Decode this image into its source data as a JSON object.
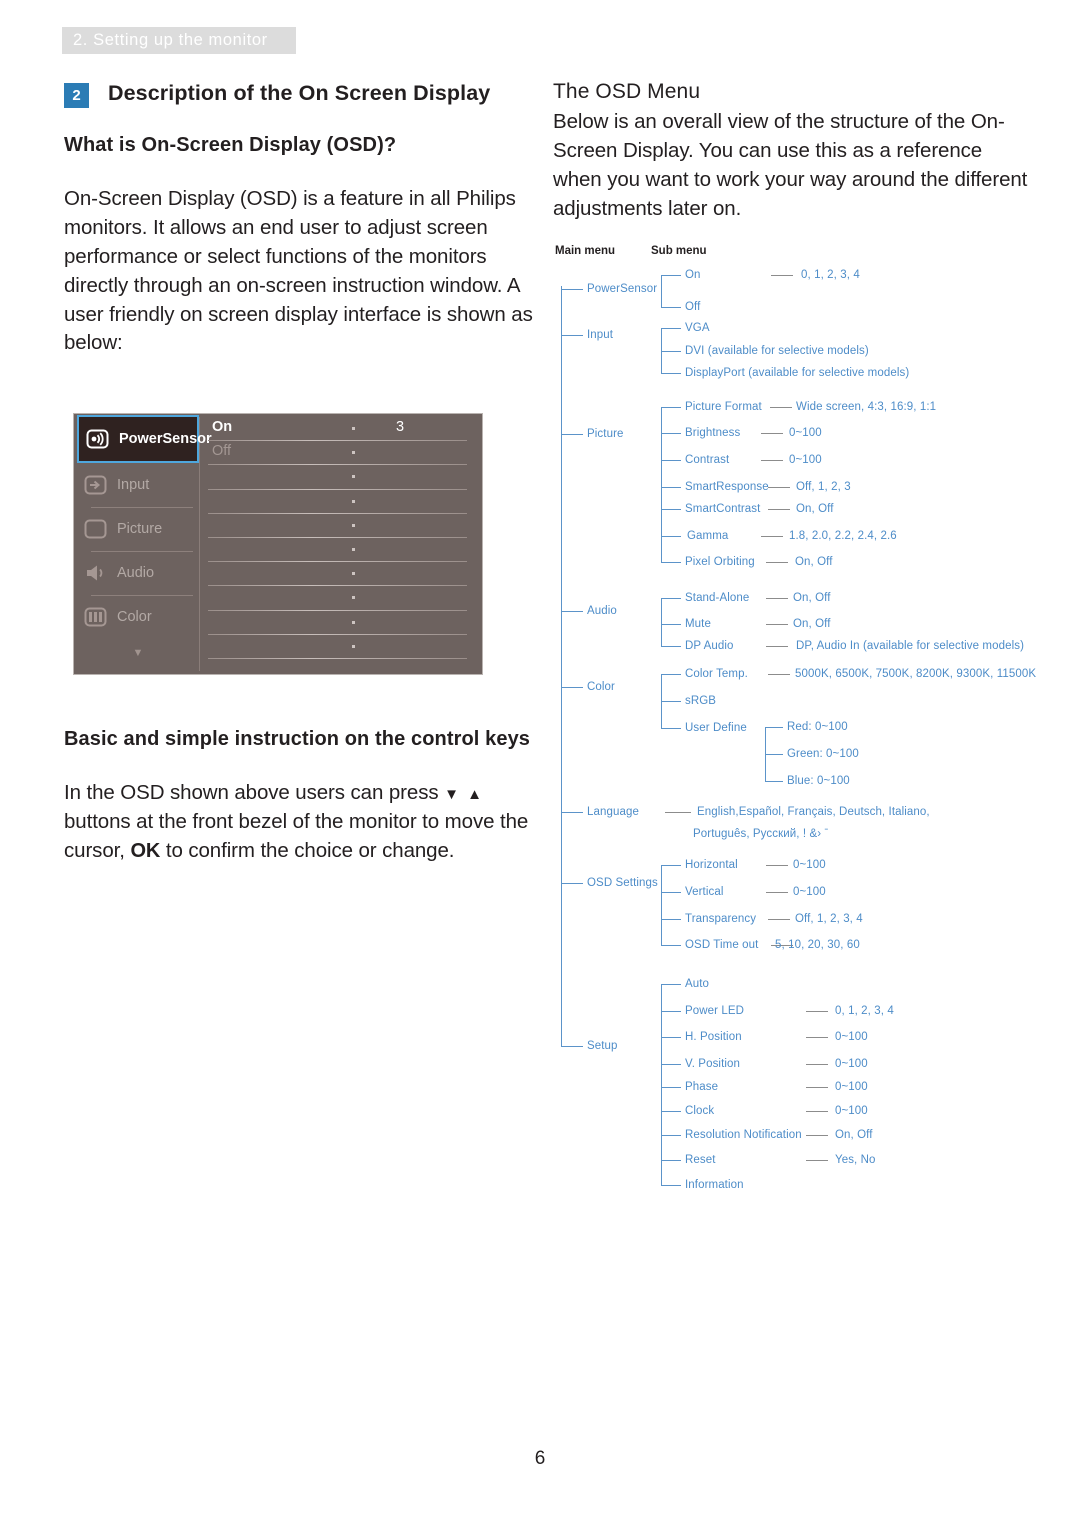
{
  "page": {
    "running_header": "2. Setting up the monitor",
    "page_number": "6"
  },
  "left_column": {
    "section_badge": "2",
    "section_title": "Description of the On Screen Display",
    "subheading_1": "What is On-Screen Display (OSD)?",
    "paragraph_1": "On-Screen Display (OSD) is a feature in all Philips monitors. It allows an end user to adjust screen performance or select functions of the monitors directly through an on-screen instruction window. A user friendly on screen display interface is shown as below:",
    "subheading_2": "Basic and simple instruction on the control keys",
    "paragraph_2_part1": "In the OSD shown above users can press",
    "paragraph_2_arrows": "▼ ▲",
    "paragraph_2_part2": "buttons at the front bezel of the monitor to move the cursor,",
    "paragraph_2_ok": "OK",
    "paragraph_2_part3": "to confirm the choice or change."
  },
  "osd_screenshot": {
    "menu_items": [
      {
        "label": "PowerSensor",
        "icon": "power-sensor-icon",
        "selected": true
      },
      {
        "label": "Input",
        "icon": "input-icon",
        "selected": false
      },
      {
        "label": "Picture",
        "icon": "picture-icon",
        "selected": false
      },
      {
        "label": "Audio",
        "icon": "audio-icon",
        "selected": false
      },
      {
        "label": "Color",
        "icon": "color-icon",
        "selected": false
      }
    ],
    "scroll_caret": "▼",
    "submenu_rows": [
      {
        "label": "On",
        "value": "3",
        "state": "on"
      },
      {
        "label": "Off",
        "value": "",
        "state": "off"
      },
      {
        "label": "",
        "value": "",
        "state": ""
      },
      {
        "label": "",
        "value": "",
        "state": ""
      },
      {
        "label": "",
        "value": "",
        "state": ""
      },
      {
        "label": "",
        "value": "",
        "state": ""
      },
      {
        "label": "",
        "value": "",
        "state": ""
      },
      {
        "label": "",
        "value": "",
        "state": ""
      },
      {
        "label": "",
        "value": "",
        "state": ""
      },
      {
        "label": "",
        "value": "",
        "state": ""
      }
    ]
  },
  "right_column": {
    "title": "The OSD Menu",
    "body": "Below is an overall view of the structure of the On-Screen Display. You can use this as a reference when you want to work your way around the different adjustments later on.",
    "col_header_main": "Main menu",
    "col_header_sub": "Sub menu"
  },
  "osd_tree": {
    "colors": {
      "text_blue": "#4d8cc8",
      "line_blue": "#5b93c9",
      "line_gray": "#8c8c8c"
    },
    "main_menu": [
      "PowerSensor",
      "Input",
      "Picture",
      "Audio",
      "Color",
      "Language",
      "OSD Settings",
      "Setup"
    ],
    "power_sensor": {
      "items": [
        "On",
        "Off"
      ],
      "on_values": "0, 1, 2, 3, 4"
    },
    "input": {
      "items": [
        "VGA",
        "DVI (available for selective models)",
        "DisplayPort (available for selective models)"
      ]
    },
    "picture": {
      "items": [
        {
          "name": "Picture Format",
          "values": "Wide screen, 4:3, 16:9, 1:1"
        },
        {
          "name": "Brightness",
          "values": "0~100"
        },
        {
          "name": "Contrast",
          "values": "0~100"
        },
        {
          "name": "SmartResponse",
          "values": "Off, 1, 2, 3"
        },
        {
          "name": "SmartContrast",
          "values": "On, Off"
        },
        {
          "name": "Gamma",
          "values": "1.8, 2.0, 2.2, 2.4, 2.6"
        },
        {
          "name": "Pixel Orbiting",
          "values": "On, Off"
        }
      ]
    },
    "audio": {
      "items": [
        {
          "name": "Stand-Alone",
          "values": "On, Off"
        },
        {
          "name": "Mute",
          "values": "On, Off"
        },
        {
          "name": "DP Audio",
          "values": "DP, Audio In (available for selective models)"
        }
      ]
    },
    "color": {
      "items": [
        {
          "name": "Color Temp.",
          "values": "5000K, 6500K, 7500K, 8200K, 9300K, 11500K"
        },
        {
          "name": "sRGB",
          "values": ""
        },
        {
          "name": "User Define",
          "values": ""
        }
      ],
      "user_define": [
        "Red: 0~100",
        "Green: 0~100",
        "Blue: 0~100"
      ]
    },
    "language": {
      "line1": "English,Español, Français, Deutsch, Italiano,",
      "line2": "Português, Русский, ! &›  ˉ"
    },
    "osd_settings": {
      "items": [
        {
          "name": "Horizontal",
          "values": "0~100"
        },
        {
          "name": "Vertical",
          "values": "0~100"
        },
        {
          "name": "Transparency",
          "values": "Off, 1, 2, 3, 4"
        },
        {
          "name": "OSD Time out",
          "values": "5, 10, 20, 30, 60"
        }
      ]
    },
    "setup": {
      "items": [
        {
          "name": "Auto",
          "values": ""
        },
        {
          "name": "Power LED",
          "values": "0, 1, 2, 3, 4"
        },
        {
          "name": "H. Position",
          "values": "0~100"
        },
        {
          "name": "V. Position",
          "values": "0~100"
        },
        {
          "name": "Phase",
          "values": "0~100"
        },
        {
          "name": "Clock",
          "values": "0~100"
        },
        {
          "name": "Resolution Notification",
          "values": "On, Off"
        },
        {
          "name": "Reset",
          "values": "Yes, No"
        },
        {
          "name": "Information",
          "values": ""
        }
      ]
    }
  }
}
